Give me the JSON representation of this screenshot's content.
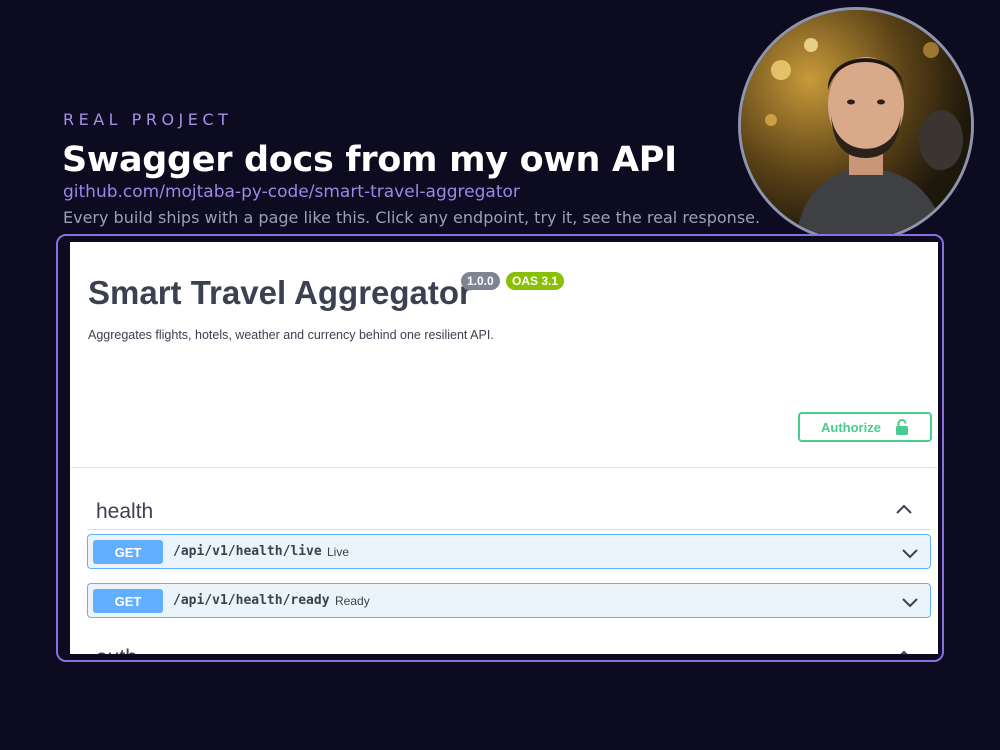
{
  "slide": {
    "eyebrow": "REAL PROJECT",
    "headline": "Swagger docs from my own API",
    "repo": "github.com/mojtaba-py-code/smart-travel-aggregator",
    "subline": "Every build ships with a page like this. Click any endpoint, try it, see the real response."
  },
  "swagger": {
    "title": "Smart Travel Aggregator",
    "version": "1.0.0",
    "oas": "OAS 3.1",
    "description": "Aggregates flights, hotels, weather and currency behind one resilient API.",
    "authorize_label": "Authorize",
    "sections": [
      {
        "name": "health",
        "operations": [
          {
            "method": "GET",
            "path": "/api/v1/health/live",
            "summary": "Live"
          },
          {
            "method": "GET",
            "path": "/api/v1/health/ready",
            "summary": "Ready"
          }
        ]
      },
      {
        "name": "auth",
        "operations": []
      }
    ]
  },
  "colors": {
    "background": "#0c0b1f",
    "accent_purple": "#a98ee6",
    "get_blue": "#61affe",
    "authorize_green": "#49cc90",
    "oas_green": "#89bf04"
  }
}
